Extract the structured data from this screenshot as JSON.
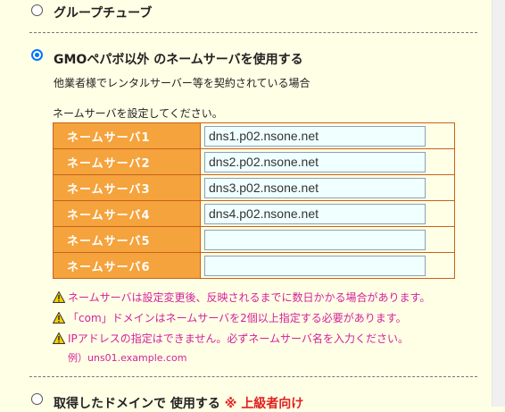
{
  "options": {
    "group_tube": "グループチューブ",
    "other_ns": "GMOペパボ以外 のネームサーバを使用する",
    "other_ns_desc": "他業者様でレンタルサーバー等を契約されている場合",
    "acquired_domain": "取得したドメインで 使用する",
    "advanced_note": "※ 上級者向け"
  },
  "nameserver_prompt": "ネームサーバを設定してください。",
  "nameservers": [
    {
      "label": "ネームサーバ1",
      "value": "dns1.p02.nsone.net"
    },
    {
      "label": "ネームサーバ2",
      "value": "dns2.p02.nsone.net"
    },
    {
      "label": "ネームサーバ3",
      "value": "dns3.p02.nsone.net"
    },
    {
      "label": "ネームサーバ4",
      "value": "dns4.p02.nsone.net"
    },
    {
      "label": "ネームサーバ5",
      "value": ""
    },
    {
      "label": "ネームサーバ6",
      "value": ""
    }
  ],
  "warnings": [
    "ネームサーバは設定変更後、反映されるまでに数日かかる場合があります。",
    "「com」ドメインはネームサーバを2個以上指定する必要があります。",
    "IPアドレスの指定はできません。必ずネームサーバ名を入力ください。"
  ],
  "example": "例）uns01.example.com",
  "colors": {
    "accent": "#f5a33d",
    "warning_text": "#d3229a",
    "input_bg": "#f0ffff",
    "page_bg": "#ffffe6"
  }
}
